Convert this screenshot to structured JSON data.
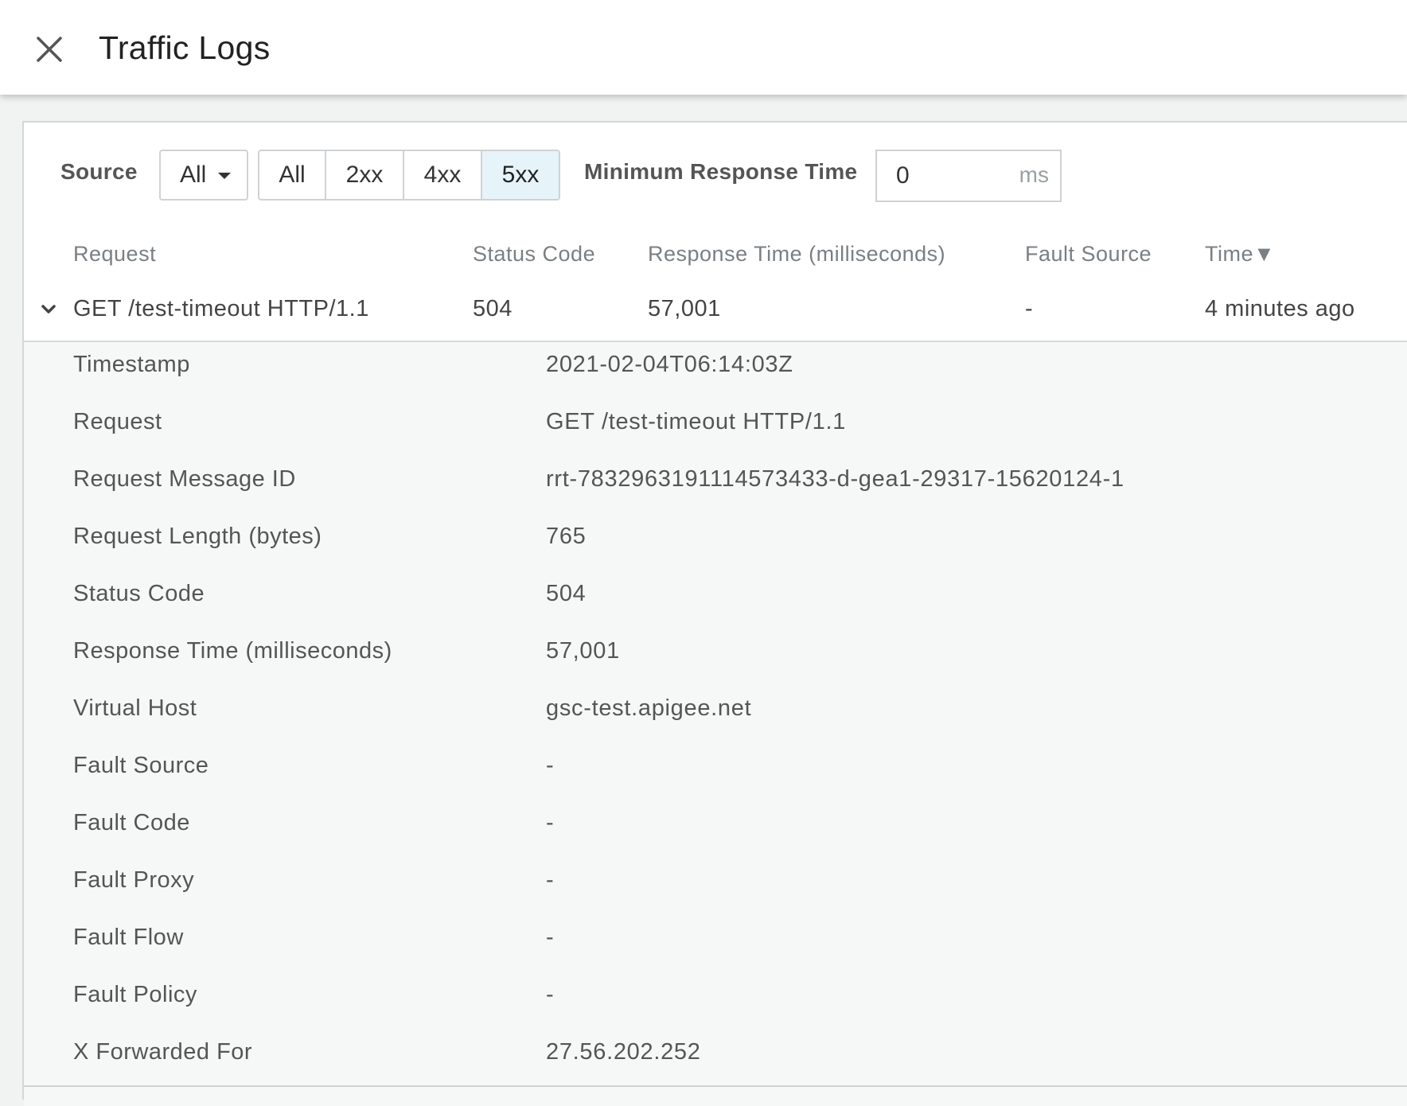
{
  "header": {
    "title": "Traffic Logs",
    "close_icon": "close-icon"
  },
  "filters": {
    "source_label": "Source",
    "source_selected": "All",
    "status_buttons": [
      "All",
      "2xx",
      "4xx",
      "5xx"
    ],
    "status_active": "5xx",
    "min_response_label": "Minimum Response Time",
    "min_response_value": "0",
    "min_response_unit": "ms"
  },
  "table": {
    "headers": {
      "request": "Request",
      "status": "Status Code",
      "response_time": "Response Time (milliseconds)",
      "fault_source": "Fault Source",
      "time": "Time▼"
    },
    "row": {
      "request": "GET /test-timeout HTTP/1.1",
      "status": "504",
      "response_time": "57,001",
      "fault_source": "-",
      "time": "4 minutes ago"
    }
  },
  "details": [
    {
      "label": "Timestamp",
      "value": "2021-02-04T06:14:03Z"
    },
    {
      "label": "Request",
      "value": "GET /test-timeout HTTP/1.1"
    },
    {
      "label": "Request Message ID",
      "value": "rrt-7832963191114573433-d-gea1-29317-15620124-1"
    },
    {
      "label": "Request Length (bytes)",
      "value": "765"
    },
    {
      "label": "Status Code",
      "value": "504"
    },
    {
      "label": "Response Time (milliseconds)",
      "value": "57,001"
    },
    {
      "label": "Virtual Host",
      "value": "gsc-test.apigee.net"
    },
    {
      "label": "Fault Source",
      "value": "-"
    },
    {
      "label": "Fault Code",
      "value": "-"
    },
    {
      "label": "Fault Proxy",
      "value": "-"
    },
    {
      "label": "Fault Flow",
      "value": "-"
    },
    {
      "label": "Fault Policy",
      "value": "-"
    },
    {
      "label": "X Forwarded For",
      "value": "27.56.202.252"
    }
  ],
  "colors": {
    "active_segment_bg": "#e6f4f9",
    "details_bg": "#f6f8f7"
  }
}
